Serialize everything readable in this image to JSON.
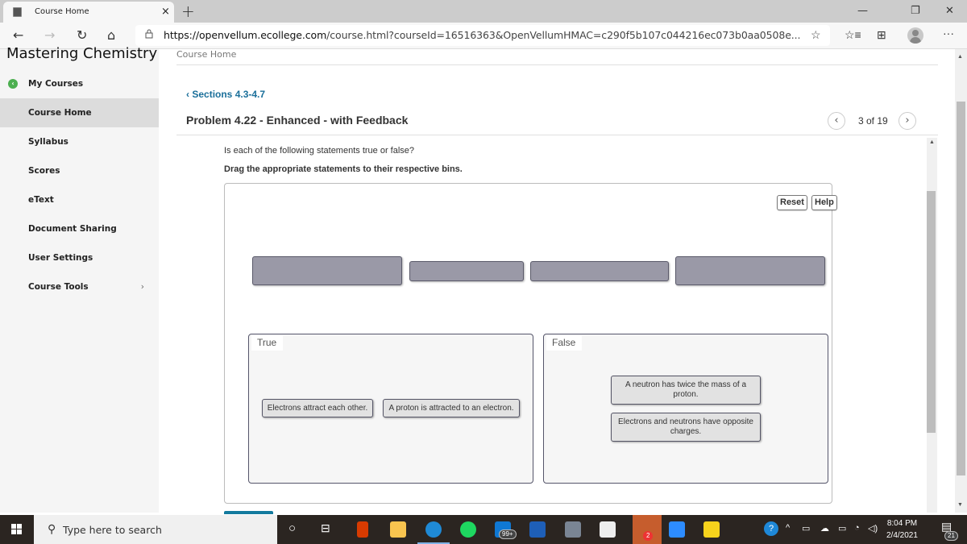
{
  "browser": {
    "tab_title": "Course Home",
    "tab_close": "×",
    "new_tab": "+",
    "window_controls": {
      "minimize": "—",
      "restore": "❐",
      "close": "✕"
    },
    "nav": {
      "back": "←",
      "forward": "→",
      "refresh": "↻",
      "home": "⌂"
    },
    "url_host": "https://openvellum.ecollege.com",
    "url_rest": "/course.html?courseId=16516363&OpenVellumHMAC=c290f5b107c044216ec073b0aa0508e...",
    "toolbar_icons": [
      "add-favorite-icon",
      "favorites-icon",
      "collections-icon",
      "profile-avatar",
      "more-icon"
    ],
    "more": "···"
  },
  "sidebar": {
    "brand": "Mastering Chemistry",
    "items": [
      {
        "label": "My Courses",
        "icon": "back-circle-icon"
      },
      {
        "label": "Course Home",
        "active": true
      },
      {
        "label": "Syllabus"
      },
      {
        "label": "Scores"
      },
      {
        "label": "eText"
      },
      {
        "label": "Document Sharing"
      },
      {
        "label": "User Settings"
      },
      {
        "label": "Course Tools",
        "chevron": "›"
      }
    ]
  },
  "main": {
    "breadcrumb": "Course Home",
    "section_link": "Sections 4.3-4.7",
    "section_chevron": "‹",
    "problem_title": "Problem 4.22 - Enhanced - with Feedback",
    "pager": {
      "prev": "‹",
      "count": "3 of 19",
      "next": "›"
    },
    "question": "Is each of the following statements true or false?",
    "instruction": "Drag the appropriate statements to their respective bins.",
    "dnd": {
      "reset_label": "Reset",
      "help_label": "Help",
      "empty_slots": 4,
      "bins": [
        {
          "label": "True",
          "cards": [
            "Electrons attract each other.",
            "A proton is attracted to an electron."
          ]
        },
        {
          "label": "False",
          "cards": [
            "A neutron has twice the mass of a proton.",
            "Electrons and neutrons have opposite charges."
          ]
        }
      ]
    }
  },
  "taskbar": {
    "search_placeholder": "Type here to search",
    "mail_badge": "99+",
    "discord_badge": "2",
    "time": "8:04 PM",
    "date": "2/4/2021",
    "notification_count": "21",
    "colors": {
      "accent": "#137a9e",
      "link": "#1a6f9a",
      "slot": "#9a99a7"
    }
  }
}
